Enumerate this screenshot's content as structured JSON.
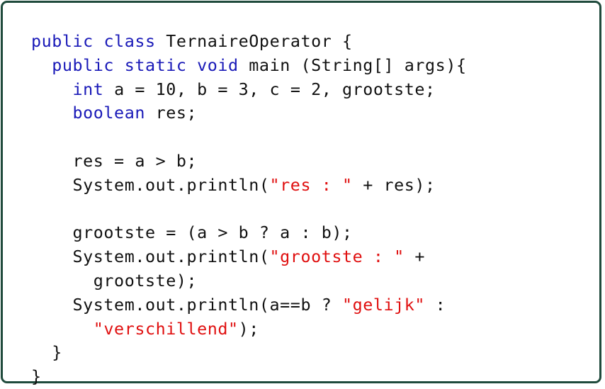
{
  "colors": {
    "border": "#1f4a3c",
    "keyword": "#1a1ab8",
    "string": "#e01010",
    "text": "#111111"
  },
  "code": {
    "lines": [
      {
        "indent": 0,
        "tokens": [
          {
            "t": "kw",
            "v": "public"
          },
          {
            "t": "plain",
            "v": " "
          },
          {
            "t": "kw",
            "v": "class"
          },
          {
            "t": "plain",
            "v": " TernaireOperator {"
          }
        ]
      },
      {
        "indent": 1,
        "tokens": [
          {
            "t": "kw",
            "v": "public"
          },
          {
            "t": "plain",
            "v": " "
          },
          {
            "t": "kw",
            "v": "static"
          },
          {
            "t": "plain",
            "v": " "
          },
          {
            "t": "kw",
            "v": "void"
          },
          {
            "t": "plain",
            "v": " main (String[] args){"
          }
        ]
      },
      {
        "indent": 2,
        "tokens": [
          {
            "t": "kw",
            "v": "int"
          },
          {
            "t": "plain",
            "v": " a = 10, b = 3, c = 2, grootste;"
          }
        ]
      },
      {
        "indent": 2,
        "tokens": [
          {
            "t": "kw",
            "v": "boolean"
          },
          {
            "t": "plain",
            "v": " res;"
          }
        ]
      },
      {
        "indent": 0,
        "tokens": []
      },
      {
        "indent": 2,
        "tokens": [
          {
            "t": "plain",
            "v": "res = a > b;"
          }
        ]
      },
      {
        "indent": 2,
        "tokens": [
          {
            "t": "plain",
            "v": "System.out.println("
          },
          {
            "t": "str",
            "v": "\"res : \""
          },
          {
            "t": "plain",
            "v": " + res);"
          }
        ]
      },
      {
        "indent": 0,
        "tokens": []
      },
      {
        "indent": 2,
        "tokens": [
          {
            "t": "plain",
            "v": "grootste = (a > b ? a : b);"
          }
        ]
      },
      {
        "indent": 2,
        "tokens": [
          {
            "t": "plain",
            "v": "System.out.println("
          },
          {
            "t": "str",
            "v": "\"grootste : \""
          },
          {
            "t": "plain",
            "v": " +"
          }
        ]
      },
      {
        "indent": 3,
        "tokens": [
          {
            "t": "plain",
            "v": "grootste);"
          }
        ]
      },
      {
        "indent": 2,
        "tokens": [
          {
            "t": "plain",
            "v": "System.out.println(a==b ? "
          },
          {
            "t": "str",
            "v": "\"gelijk\""
          },
          {
            "t": "plain",
            "v": " :"
          }
        ]
      },
      {
        "indent": 3,
        "tokens": [
          {
            "t": "str",
            "v": "\"verschillend\""
          },
          {
            "t": "plain",
            "v": ");"
          }
        ]
      },
      {
        "indent": 1,
        "tokens": [
          {
            "t": "plain",
            "v": "}"
          }
        ]
      },
      {
        "indent": 0,
        "tokens": [
          {
            "t": "plain",
            "v": "}"
          }
        ]
      }
    ]
  }
}
